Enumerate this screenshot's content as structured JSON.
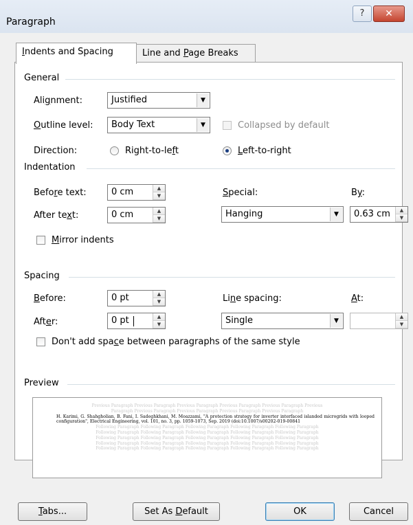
{
  "window": {
    "title": "Paragraph",
    "help_glyph": "?",
    "close_glyph": "✕"
  },
  "tabs": [
    {
      "label_pre": "",
      "label_u": "I",
      "label_post": "ndents and Spacing"
    },
    {
      "label_pre": "Line and ",
      "label_u": "P",
      "label_post": "age Breaks"
    }
  ],
  "general": {
    "heading": "General",
    "alignment": {
      "label_pre": "Ali",
      "label_u": "g",
      "label_post": "nment:",
      "value": "Justified"
    },
    "outline": {
      "label_pre": "",
      "label_u": "O",
      "label_post": "utline level:",
      "value": "Body Text"
    },
    "collapsed": {
      "label": "Collapsed by default",
      "checked": false,
      "enabled": false
    },
    "direction": {
      "label": "Direction:",
      "rtl": {
        "label_pre": "Right-to-le",
        "label_u": "f",
        "label_post": "t",
        "selected": false
      },
      "ltr": {
        "label_pre": "",
        "label_u": "L",
        "label_post": "eft-to-right",
        "selected": true
      }
    }
  },
  "indentation": {
    "heading": "Indentation",
    "before": {
      "label_pre": "Befo",
      "label_u": "r",
      "label_post": "e text:",
      "value": "0 cm"
    },
    "after": {
      "label_pre": "After te",
      "label_u": "x",
      "label_post": "t:",
      "value": "0 cm"
    },
    "special": {
      "label_pre": "",
      "label_u": "S",
      "label_post": "pecial:",
      "value": "Hanging"
    },
    "by": {
      "label_pre": "B",
      "label_u": "y",
      "label_post": ":",
      "value": "0.63 cm"
    },
    "mirror": {
      "label_pre": "",
      "label_u": "M",
      "label_post": "irror indents",
      "checked": false
    }
  },
  "spacing": {
    "heading": "Spacing",
    "before": {
      "label_pre": "",
      "label_u": "B",
      "label_post": "efore:",
      "value": "0 pt"
    },
    "after": {
      "label_pre": "Aft",
      "label_u": "e",
      "label_post": "r:",
      "value": "0 pt"
    },
    "line_spacing": {
      "label_pre": "Li",
      "label_u": "n",
      "label_post": "e spacing:",
      "value": "Single"
    },
    "at": {
      "label_pre": "",
      "label_u": "A",
      "label_post": "t:",
      "value": ""
    },
    "dont_add": {
      "label_pre": "Don't add spa",
      "label_u": "c",
      "label_post": "e between paragraphs of the same style",
      "checked": false
    }
  },
  "preview": {
    "heading": "Preview",
    "prev_lines": [
      "Previous Paragraph Previous Paragraph Previous Paragraph Previous Paragraph Previous Paragraph Previous",
      "Paragraph Previous Paragraph Previous Paragraph Previous Paragraph Previous Paragraph"
    ],
    "main_text": "H. Karimi, G. Shahgholian, B. Fani, I. Sadeghkhani, M. Moazzami, \"A protection strategy for inverter interfaced islanded microgrids with looped configuration\", Electrical Engineering, vol. 101, no. 3, pp. 1059-1073, Sep. 2019 (doi:10.1007/s00202-019-00841",
    "follow_lines": [
      "Following Paragraph Following Paragraph Following Paragraph Following Paragraph Following Paragraph",
      "Following Paragraph Following Paragraph Following Paragraph Following Paragraph Following Paragraph",
      "Following Paragraph Following Paragraph Following Paragraph Following Paragraph Following Paragraph",
      "Following Paragraph Following Paragraph Following Paragraph Following Paragraph Following Paragraph",
      "Following Paragraph Following Paragraph Following Paragraph Following Paragraph Following Paragraph"
    ]
  },
  "buttons": {
    "tabs": {
      "label_pre": "",
      "label_u": "T",
      "label_post": "abs..."
    },
    "set_default": {
      "label_pre": "Set As ",
      "label_u": "D",
      "label_post": "efault"
    },
    "ok": {
      "label": "OK"
    },
    "cancel": {
      "label": "Cancel"
    }
  },
  "icons": {
    "dropdown": "chevron-down-icon",
    "spin_up": "spin-up-icon",
    "spin_down": "spin-down-icon",
    "radio_selected": "radio-dot-icon"
  }
}
